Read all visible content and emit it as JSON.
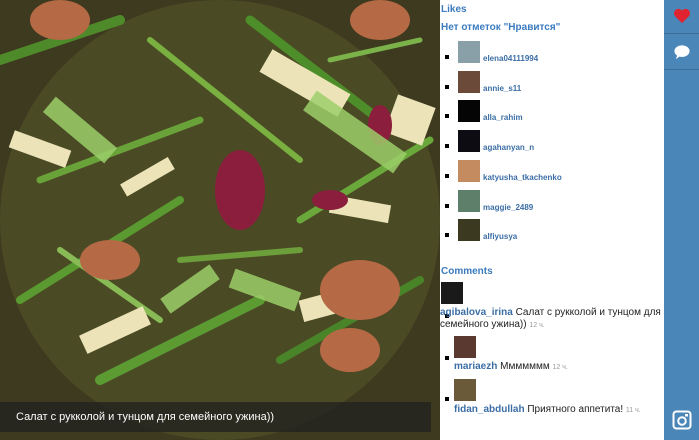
{
  "photo": {
    "caption": "Салат с рукколой и тунцом для семейного ужина))"
  },
  "likes": {
    "title": "Likes",
    "none_text": "Нет отметок \"Нравится\"",
    "users": [
      {
        "name": "elena04111994",
        "avatar": "#8aa0a8"
      },
      {
        "name": "annie_s11",
        "avatar": "#6b4a3a"
      },
      {
        "name": "alla_rahim",
        "avatar": "#050505"
      },
      {
        "name": "agahanyan_n",
        "avatar": "#0c0c12"
      },
      {
        "name": "katyusha_tkachenko",
        "avatar": "#c48a60"
      },
      {
        "name": "maggie_2489",
        "avatar": "#5e7f6a"
      },
      {
        "name": "alfiyusya",
        "avatar": "#3b3a20"
      }
    ]
  },
  "comments": {
    "title": "Comments",
    "items": [
      {
        "user": "agibalova_irina",
        "text": "Салат с рукколой и тунцом для семейного ужина))",
        "time": "12 ч.",
        "avatar": "#1a1a1a"
      },
      {
        "user": "mariaezh",
        "text": "Ммммммм",
        "time": "12 ч.",
        "avatar": "#5a3a30"
      },
      {
        "user": "fidan_abdullah",
        "text": "Приятного аппетита!",
        "time": "11 ч.",
        "avatar": "#6a5a3a"
      }
    ]
  },
  "sidebar": {
    "icons": [
      "heart-icon",
      "comment-icon",
      "instagram-icon"
    ]
  },
  "colors": {
    "link": "#3b7bbf",
    "sidebar": "#4a86b8",
    "heart": "#e0232f"
  }
}
